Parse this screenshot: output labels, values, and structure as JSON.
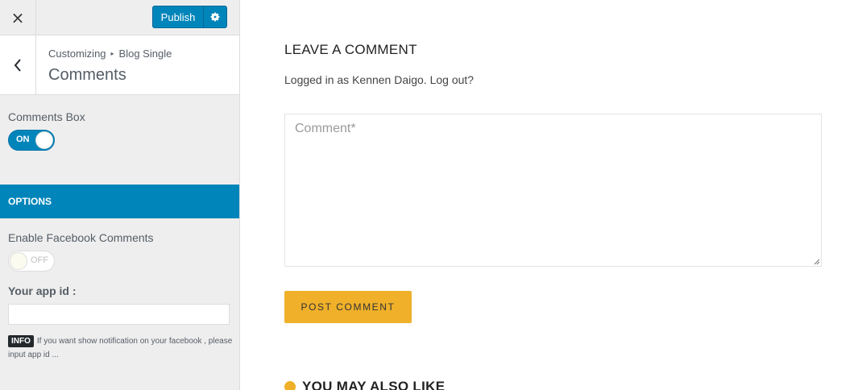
{
  "sidebar": {
    "close_icon": "×",
    "publish_label": "Publish",
    "breadcrumb": {
      "root": "Customizing",
      "separator": "▸",
      "parent": "Blog Single"
    },
    "section_title": "Comments",
    "comments_box": {
      "label": "Comments Box",
      "toggle_text": "ON",
      "state": true
    },
    "options_header": "OPTIONS",
    "facebook_comments": {
      "label": "Enable Facebook Comments",
      "toggle_text": "OFF",
      "state": false
    },
    "app_id": {
      "label": "Your app id :",
      "value": ""
    },
    "info": {
      "badge": "INFO",
      "text": "If you want show notification on your facebook , please input app id ..."
    },
    "accent_color": "#0085ba"
  },
  "preview": {
    "leave_title": "LEAVE A COMMENT",
    "logged_in_text": "Logged in as Kennen Daigo. Log out?",
    "comment_placeholder": "Comment*",
    "post_button": "POST COMMENT",
    "may_also_like": "YOU MAY ALSO LIKE",
    "button_color": "#f0b02a"
  }
}
